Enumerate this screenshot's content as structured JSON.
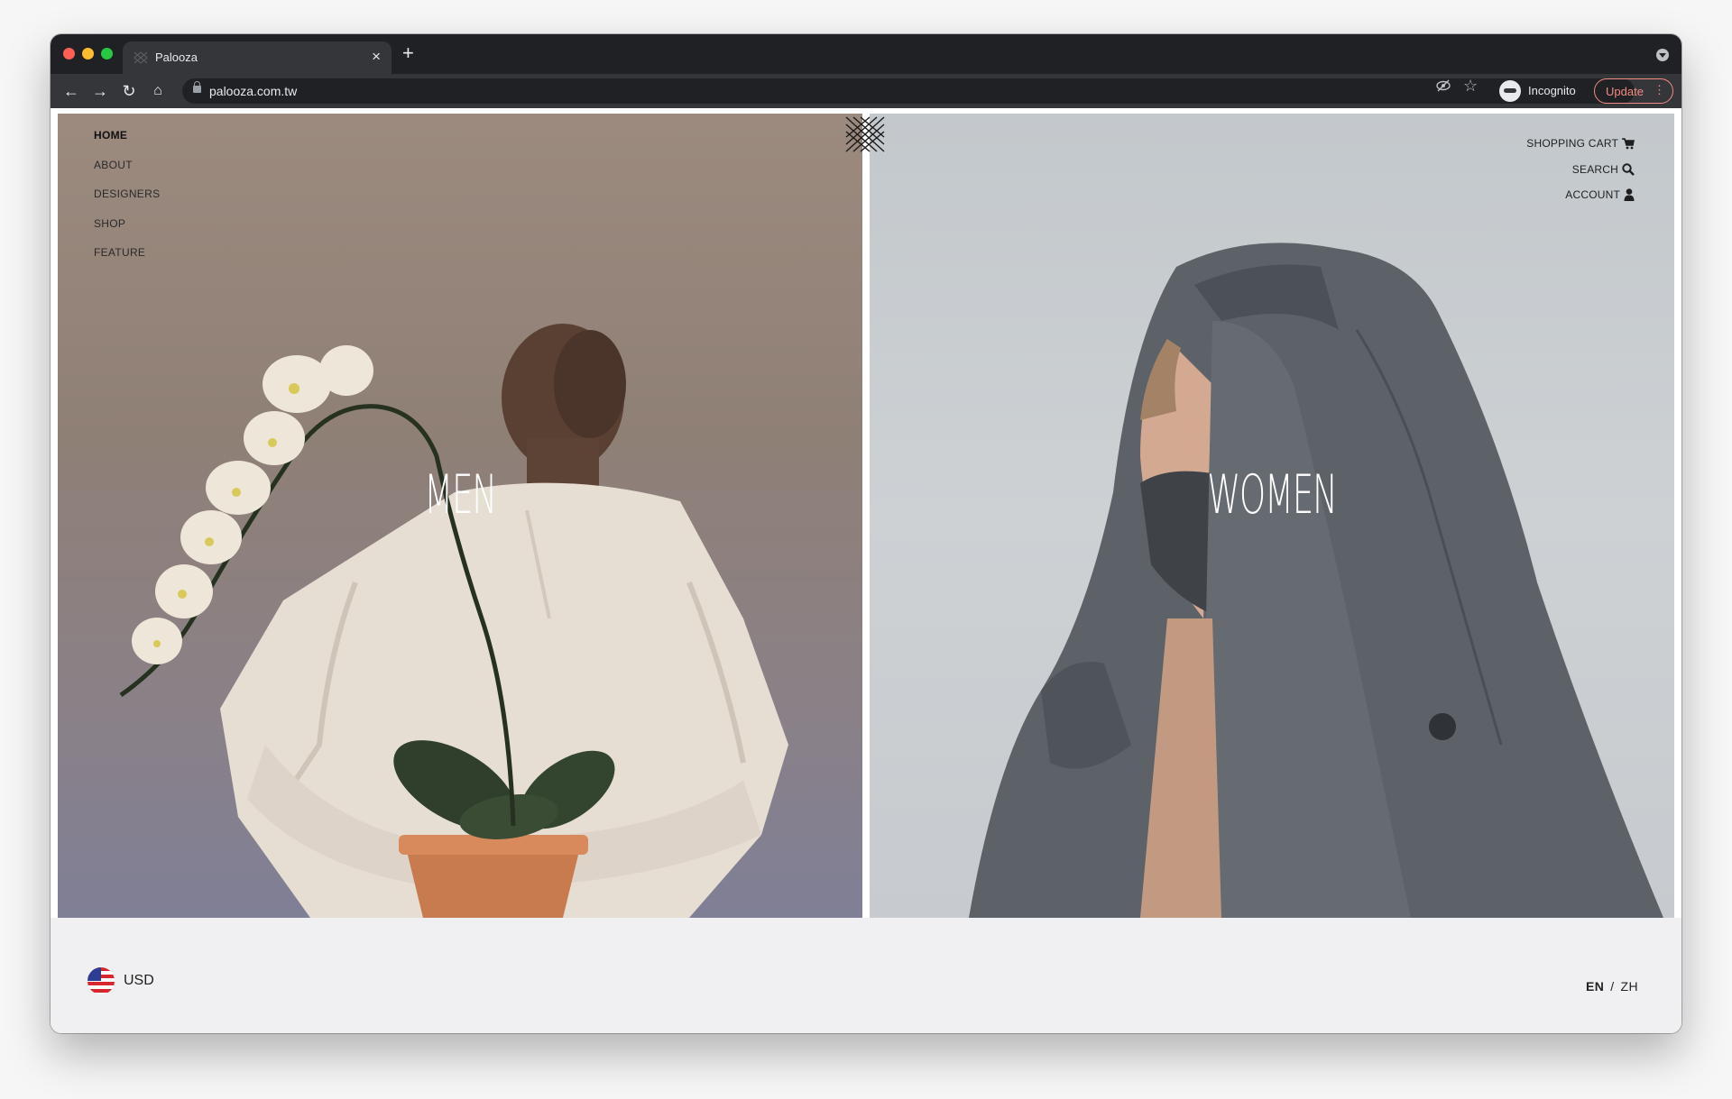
{
  "browser": {
    "tab_title": "Palooza",
    "url": "palooza.com.tw",
    "incognito_label": "Incognito",
    "update_label": "Update"
  },
  "site": {
    "nav": [
      "HOME",
      "ABOUT",
      "DESIGNERS",
      "SHOP",
      "FEATURE"
    ],
    "utility": {
      "cart": "SHOPPING CART",
      "search": "SEARCH",
      "account": "ACCOUNT"
    },
    "panels": {
      "men": "MEN",
      "women": "WOMEN"
    },
    "footer": {
      "currency": "USD",
      "lang_en": "EN",
      "lang_sep": "/",
      "lang_zh": "ZH"
    }
  },
  "colors": {
    "chrome_dark": "#202124",
    "chrome_toolbar": "#35363a",
    "update_accent": "#f28b82",
    "men_panel": "#8f8076",
    "women_panel": "#c7cbcf"
  }
}
